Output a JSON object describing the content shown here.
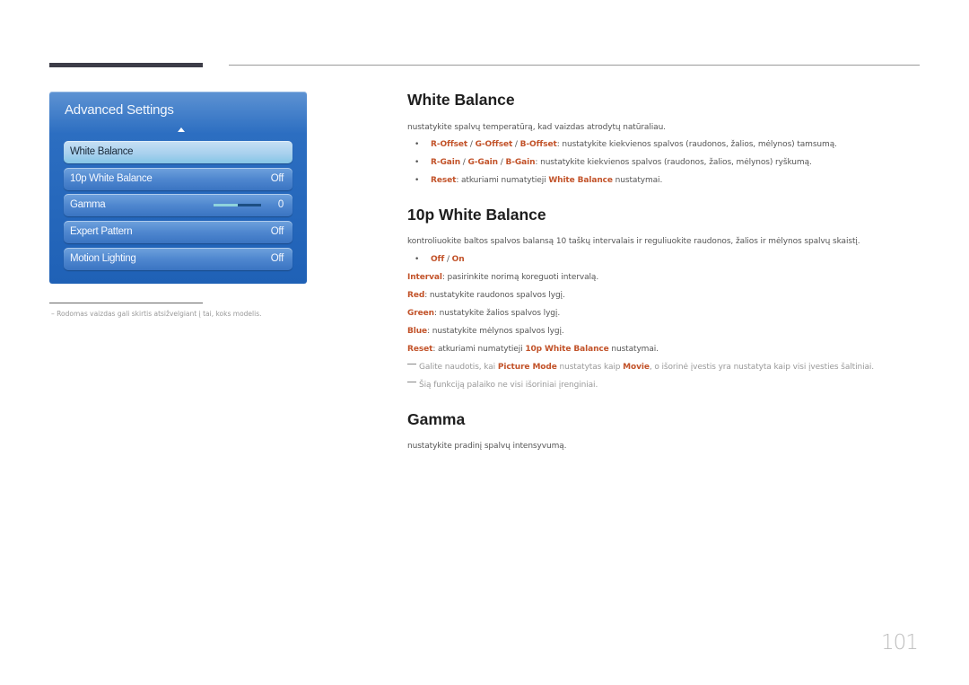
{
  "osd": {
    "title": "Advanced Settings",
    "items": [
      {
        "label": "White Balance",
        "value": "",
        "selected": true
      },
      {
        "label": "10p White Balance",
        "value": "Off"
      },
      {
        "label": "Gamma",
        "value": "0",
        "slider_fraction": 0.5
      },
      {
        "label": "Expert Pattern",
        "value": "Off"
      },
      {
        "label": "Motion Lighting",
        "value": "Off"
      }
    ]
  },
  "footnote": "Rodomas vaizdas gali skirtis atsižvelgiant į tai, koks modelis.",
  "footnote_dash": "–",
  "sections": {
    "white_balance": {
      "title": "White Balance",
      "desc": "nustatykite spalvų temperatūrą, kad vaizdas atrodytų natūraliau.",
      "b1": {
        "a": "R-Offset",
        "s1": " / ",
        "b": "G-Offset",
        "s2": " / ",
        "c": "B-Offset",
        "rest": ": nustatykite kiekvienos spalvos (raudonos, žalios, mėlynos) tamsumą."
      },
      "b2": {
        "a": "R-Gain",
        "s1": " / ",
        "b": "G-Gain",
        "s2": " / ",
        "c": "B-Gain",
        "rest": ": nustatykite kiekvienos spalvos (raudonos, žalios, mėlynos) ryškumą."
      },
      "b3": {
        "a": "Reset",
        "mid": ": atkuriami numatytieji ",
        "b": "White Balance",
        "rest": " nustatymai."
      }
    },
    "tenp": {
      "title": "10p White Balance",
      "desc": "kontroliuokite baltos spalvos balansą 10 taškų intervalais ir reguliuokite raudonos, žalios ir mėlynos spalvų skaistį.",
      "opt": {
        "a": "Off",
        "s": " / ",
        "b": "On"
      },
      "interval": {
        "k": "Interval",
        "v": ": pasirinkite norimą koreguoti intervalą."
      },
      "red": {
        "k": "Red",
        "v": ": nustatykite raudonos spalvos lygį."
      },
      "green": {
        "k": "Green",
        "v": ": nustatykite žalios spalvos lygį."
      },
      "blue": {
        "k": "Blue",
        "v": ": nustatykite mėlynos spalvos lygį."
      },
      "reset": {
        "k": "Reset",
        "mid": ": atkuriami numatytieji ",
        "b": "10p White Balance",
        "rest": " nustatymai."
      },
      "note1": {
        "a": "Galite naudotis, kai ",
        "b": "Picture Mode",
        "c": " nustatytas kaip ",
        "d": "Movie",
        "e": ", o išorinė įvestis yra nustatyta kaip visi įvesties šaltiniai."
      },
      "note2": "Šią funkciją palaiko ne visi išoriniai įrenginiai."
    },
    "gamma": {
      "title": "Gamma",
      "desc": "nustatykite pradinį spalvų intensyvumą."
    }
  },
  "bullet_char": "•",
  "page_number": "101",
  "colors": {
    "accent": "#c2532a",
    "osd_blue": "#1f61b6"
  }
}
